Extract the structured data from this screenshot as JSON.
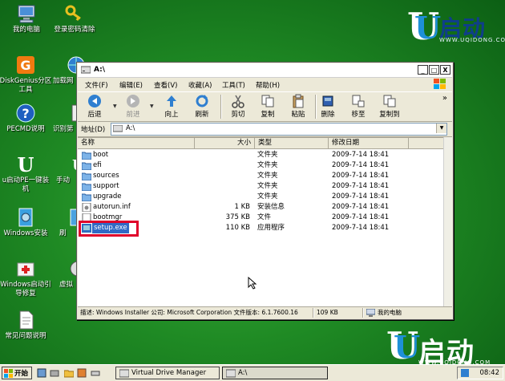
{
  "desktop": {
    "icons": [
      {
        "label": "我的电脑"
      },
      {
        "label": "登录密码清除"
      },
      {
        "label": "DiskGenius分区工具"
      },
      {
        "label": "加载网"
      },
      {
        "label": "PECMD说明"
      },
      {
        "label": "识别第"
      },
      {
        "label": "u启动PE一键装机"
      },
      {
        "label": "手动"
      },
      {
        "label": "Windows安装"
      },
      {
        "label": "刷"
      },
      {
        "label": "Windows启动引导修复"
      },
      {
        "label": "虚拟"
      },
      {
        "label": "常见问题说明"
      }
    ],
    "brand_top": {
      "cn": "启动",
      "url": "WWW.UQIDONG.COM"
    },
    "brand_bottom": {
      "cn": "启动",
      "url": "WWW.UQIDONG.COM"
    }
  },
  "window": {
    "title": "A:\\",
    "controls": {
      "minimize": "_",
      "maximize": "□",
      "close": "X"
    },
    "menu": [
      "文件(F)",
      "编辑(E)",
      "查看(V)",
      "收藏(A)",
      "工具(T)",
      "帮助(H)"
    ],
    "toolbar": {
      "back": "后退",
      "forward": "前进",
      "up": "向上",
      "refresh": "刷新",
      "cut": "剪切",
      "copy": "复制",
      "paste": "粘贴",
      "delete": "删除",
      "move_to": "移至",
      "copy_to": "复制到",
      "more": "»"
    },
    "address": {
      "label": "地址(D)",
      "value": "A:\\"
    },
    "columns": {
      "name": "名称",
      "size": "大小",
      "type": "类型",
      "modified": "修改日期"
    },
    "files": [
      {
        "name": "boot",
        "size": "",
        "type": "文件夹",
        "modified": "2009-7-14 18:41"
      },
      {
        "name": "efi",
        "size": "",
        "type": "文件夹",
        "modified": "2009-7-14 18:41"
      },
      {
        "name": "sources",
        "size": "",
        "type": "文件夹",
        "modified": "2009-7-14 18:41"
      },
      {
        "name": "support",
        "size": "",
        "type": "文件夹",
        "modified": "2009-7-14 18:41"
      },
      {
        "name": "upgrade",
        "size": "",
        "type": "文件夹",
        "modified": "2009-7-14 18:41"
      },
      {
        "name": "autorun.inf",
        "size": "1 KB",
        "type": "安装信息",
        "modified": "2009-7-14 18:41"
      },
      {
        "name": "bootmgr",
        "size": "375 KB",
        "type": "文件",
        "modified": "2009-7-14 18:41"
      },
      {
        "name": "setup.exe",
        "size": "110 KB",
        "type": "应用程序",
        "modified": "2009-7-14 18:41"
      }
    ],
    "status": {
      "description": "描述: Windows Installer 公司: Microsoft Corporation 文件版本: 6.1.7600.16",
      "size": "109 KB",
      "location": "我的电脑"
    }
  },
  "taskbar": {
    "start": "开始",
    "tasks": [
      {
        "label": "Virtual Drive Manager"
      },
      {
        "label": "A:\\"
      }
    ],
    "clock": "08:42"
  },
  "colors": {
    "accent_red": "#e0002a",
    "selection": "#316ac5",
    "desktop_green": "#1f8a24"
  }
}
